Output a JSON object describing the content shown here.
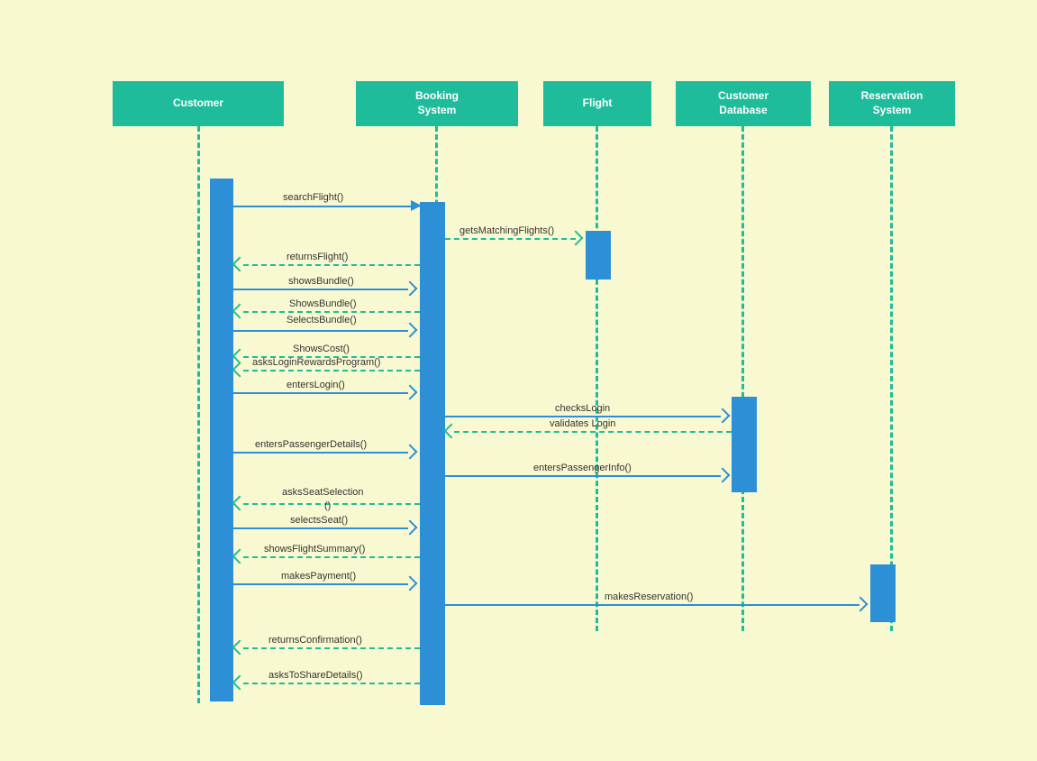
{
  "actors": {
    "customer": "Customer",
    "booking": "Booking\nSystem",
    "flight": "Flight",
    "db": "Customer\nDatabase",
    "reservation": "Reservation\nSystem"
  },
  "messages": {
    "m1": "searchFlight()",
    "m2": "getsMatchingFlights()",
    "m3": "returnsFlight()",
    "m4": "showsBundle()",
    "m5": "ShowsBundle()",
    "m6": "SelectsBundle()",
    "m7": "ShowsCost()",
    "m8": "asksLoginRewardsProgram()",
    "m9": "entersLogin()",
    "m10": "checksLogin",
    "m11": "validates Login",
    "m12": "entersPassengerDetails()",
    "m13": "entersPassengerInfo()",
    "m14a": "asksSeatSelection",
    "m14b": "()",
    "m15": "selectsSeat()",
    "m16": "showsFlightSummary()",
    "m17": "makesPayment()",
    "m18": "makesReservation()",
    "m19": "returnsConfirmation()",
    "m20": "asksToShareDetails()"
  }
}
